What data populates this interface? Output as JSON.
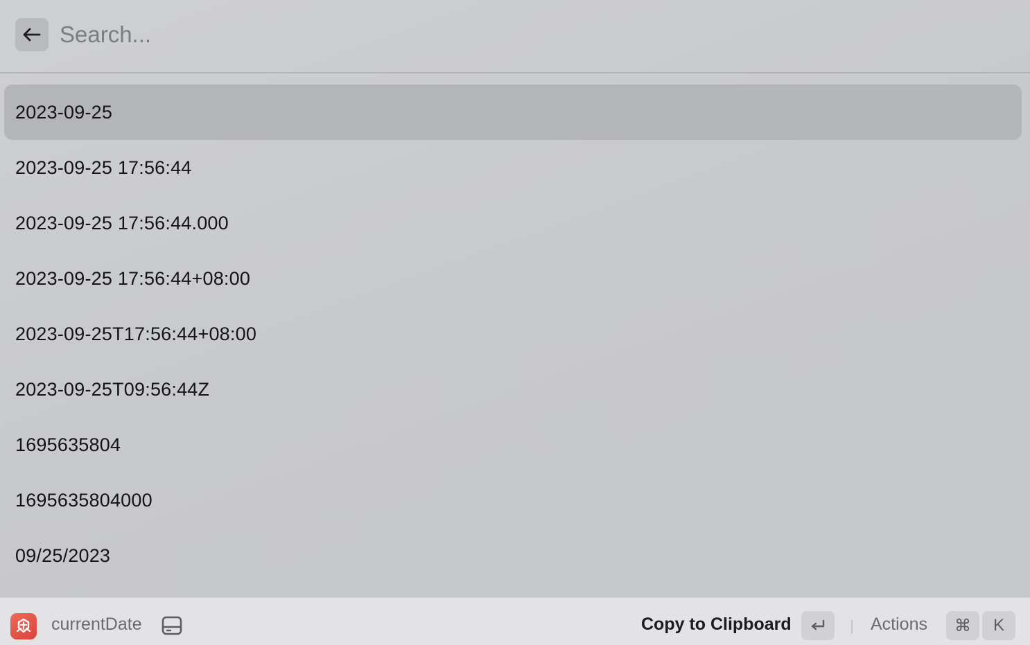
{
  "search": {
    "placeholder": "Search...",
    "value": ""
  },
  "list": {
    "selected_index": 0,
    "items": [
      {
        "label": "2023-09-25"
      },
      {
        "label": "2023-09-25 17:56:44"
      },
      {
        "label": "2023-09-25 17:56:44.000"
      },
      {
        "label": "2023-09-25 17:56:44+08:00"
      },
      {
        "label": "2023-09-25T17:56:44+08:00"
      },
      {
        "label": "2023-09-25T09:56:44Z"
      },
      {
        "label": "1695635804"
      },
      {
        "label": "1695635804000"
      },
      {
        "label": "09/25/2023"
      }
    ]
  },
  "footer": {
    "extension_icon": "date-extension-icon",
    "extension_name": "currentDate",
    "secondary_icon": "drive-icon",
    "primary_action": "Copy to Clipboard",
    "primary_shortcut_icon": "return-key-icon",
    "actions_label": "Actions",
    "actions_shortcut_modifier": "⌘",
    "actions_shortcut_key": "K"
  },
  "colors": {
    "selected_row": "#b4b5b8",
    "extension_icon": "#e0493f",
    "footer_bg": "#e3e3e5"
  }
}
